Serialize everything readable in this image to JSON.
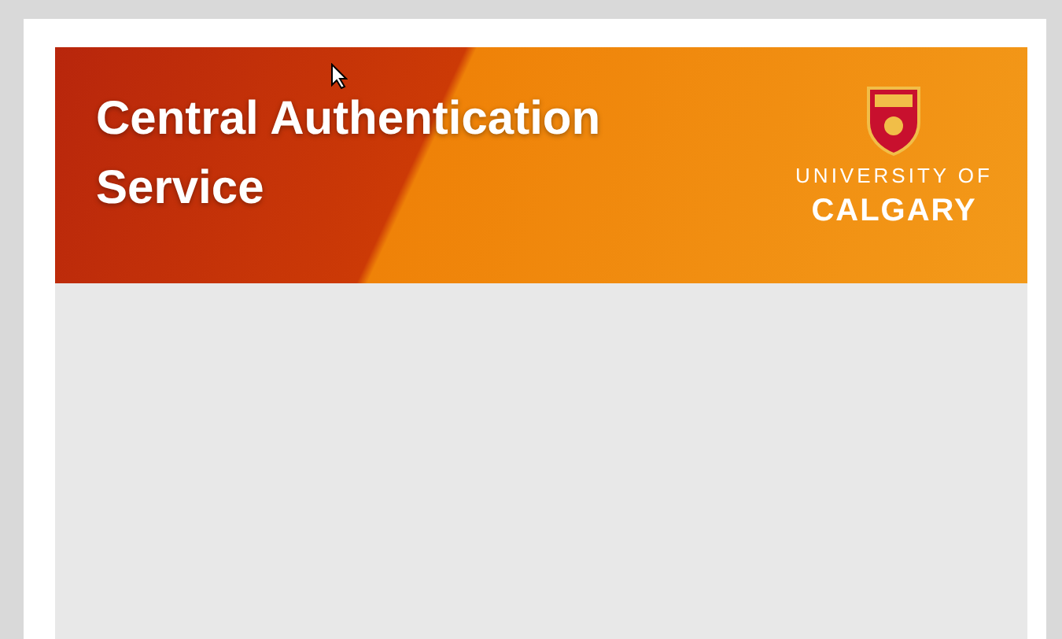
{
  "banner": {
    "title": "Central Authentication Service",
    "logo_lines": [
      "UNIVERSITY OF",
      "CALGARY"
    ]
  }
}
